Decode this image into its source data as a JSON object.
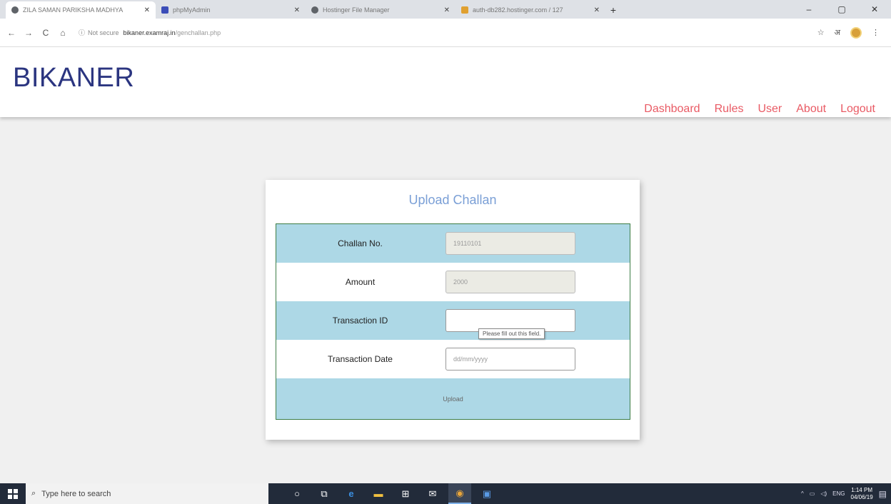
{
  "browser": {
    "tabs": [
      {
        "title": "ZILA SAMAN PARIKSHA MADHYA",
        "icon_color": "#5f6368",
        "active": true
      },
      {
        "title": "phpMyAdmin",
        "icon_color": "#3b4db8",
        "active": false
      },
      {
        "title": "Hostinger File Manager",
        "icon_color": "#5f6368",
        "active": false
      },
      {
        "title": "auth-db282.hostinger.com / 127",
        "icon_color": "#e0a030",
        "active": false
      }
    ],
    "new_tab": "+",
    "window_controls": {
      "minimize": "–",
      "maximize": "▢",
      "close": "✕"
    },
    "nav": {
      "back": "←",
      "forward": "→",
      "reload": "C",
      "home": "⌂"
    },
    "address": {
      "security": "Not secure",
      "domain": "bikaner.examraj.in",
      "path": "/genchallan.php"
    },
    "toolbar_icons": {
      "bookmark": "☆",
      "translate": "अ",
      "menu": "⋮"
    }
  },
  "site": {
    "brand": "BIKANER",
    "nav": [
      "Dashboard",
      "Rules",
      "User",
      "About",
      "Logout"
    ]
  },
  "form": {
    "title": "Upload Challan",
    "fields": {
      "challan_no": {
        "label": "Challan No.",
        "value": "19110101"
      },
      "amount": {
        "label": "Amount",
        "value": "2000"
      },
      "transaction_id": {
        "label": "Transaction ID",
        "value": ""
      },
      "transaction_date": {
        "label": "Transaction Date",
        "placeholder": "dd/mm/yyyy"
      }
    },
    "validation_tooltip": "Please fill out this field.",
    "submit_label": "Upload"
  },
  "taskbar": {
    "search_placeholder": "Type here to search",
    "tray": {
      "lang": "ENG",
      "time": "1:14 PM",
      "date": "04/06/19"
    }
  },
  "colors": {
    "brand": "#2b3580",
    "nav_link": "#e95a64",
    "form_row": "#add8e6",
    "form_border": "#3d7d46",
    "title": "#7a9fd6"
  }
}
